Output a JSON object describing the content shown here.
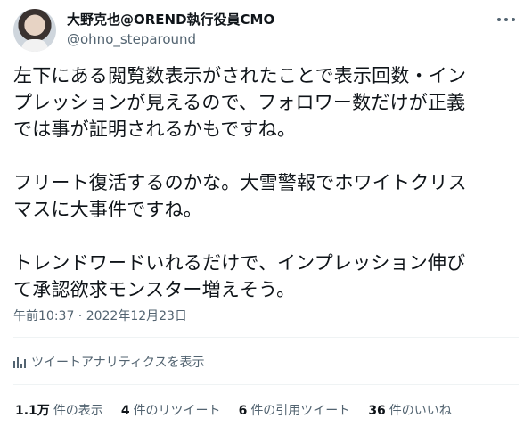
{
  "header": {
    "display_name": "大野克也@OREND執行役員CMO",
    "handle": "@ohno_steparound",
    "more_icon": "more-horizontal-icon"
  },
  "tweet": {
    "lines": [
      "左下にある閲覧数表示がされたことで表示回数・イン",
      "プレッションが見えるので、フォロワー数だけが正義",
      "では事が証明されるかもですね。",
      "",
      "フリート復活するのかな。大雪警報でホワイトクリス",
      "マスに大事件ですね。",
      "",
      "トレンドワードいれるだけで、インプレッション伸び",
      "て承認欲求モンスター増えそう。"
    ]
  },
  "timestamp": "午前10:37 · 2022年12月23日",
  "analytics": {
    "icon": "analytics-bars-icon",
    "label": "ツイートアナリティクスを表示"
  },
  "stats": [
    {
      "count": "1.1万",
      "label": "件の表示"
    },
    {
      "count": "4",
      "label": "件のリツイート"
    },
    {
      "count": "6",
      "label": "件の引用ツイート"
    },
    {
      "count": "36",
      "label": "件のいいね"
    }
  ],
  "colors": {
    "text": "#0f1419",
    "secondary": "#536471",
    "divider": "#eff3f4",
    "background": "#ffffff"
  }
}
